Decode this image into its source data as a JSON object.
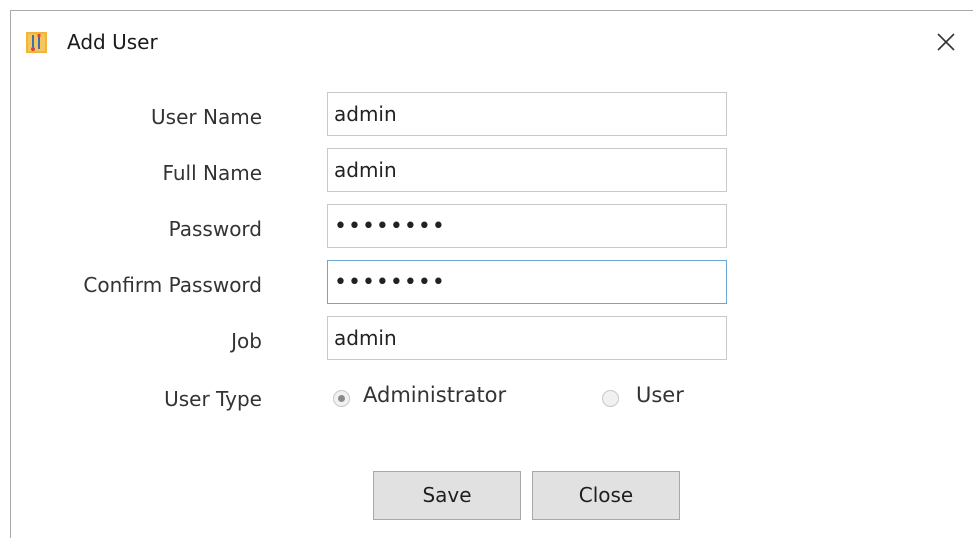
{
  "window": {
    "title": "Add User",
    "app_icon": "app-icon",
    "close_icon": "close-icon"
  },
  "form": {
    "user_name": {
      "label": "User Name",
      "value": "admin"
    },
    "full_name": {
      "label": "Full Name",
      "value": "admin"
    },
    "password": {
      "label": "Password",
      "value": "••••••••"
    },
    "confirm_password": {
      "label": "Confirm Password",
      "value": "••••••••"
    },
    "job": {
      "label": "Job",
      "value": "admin"
    },
    "user_type": {
      "label": "User Type",
      "options": [
        "Administrator",
        "User"
      ],
      "selected": "Administrator"
    }
  },
  "buttons": {
    "save": "Save",
    "close": "Close"
  }
}
